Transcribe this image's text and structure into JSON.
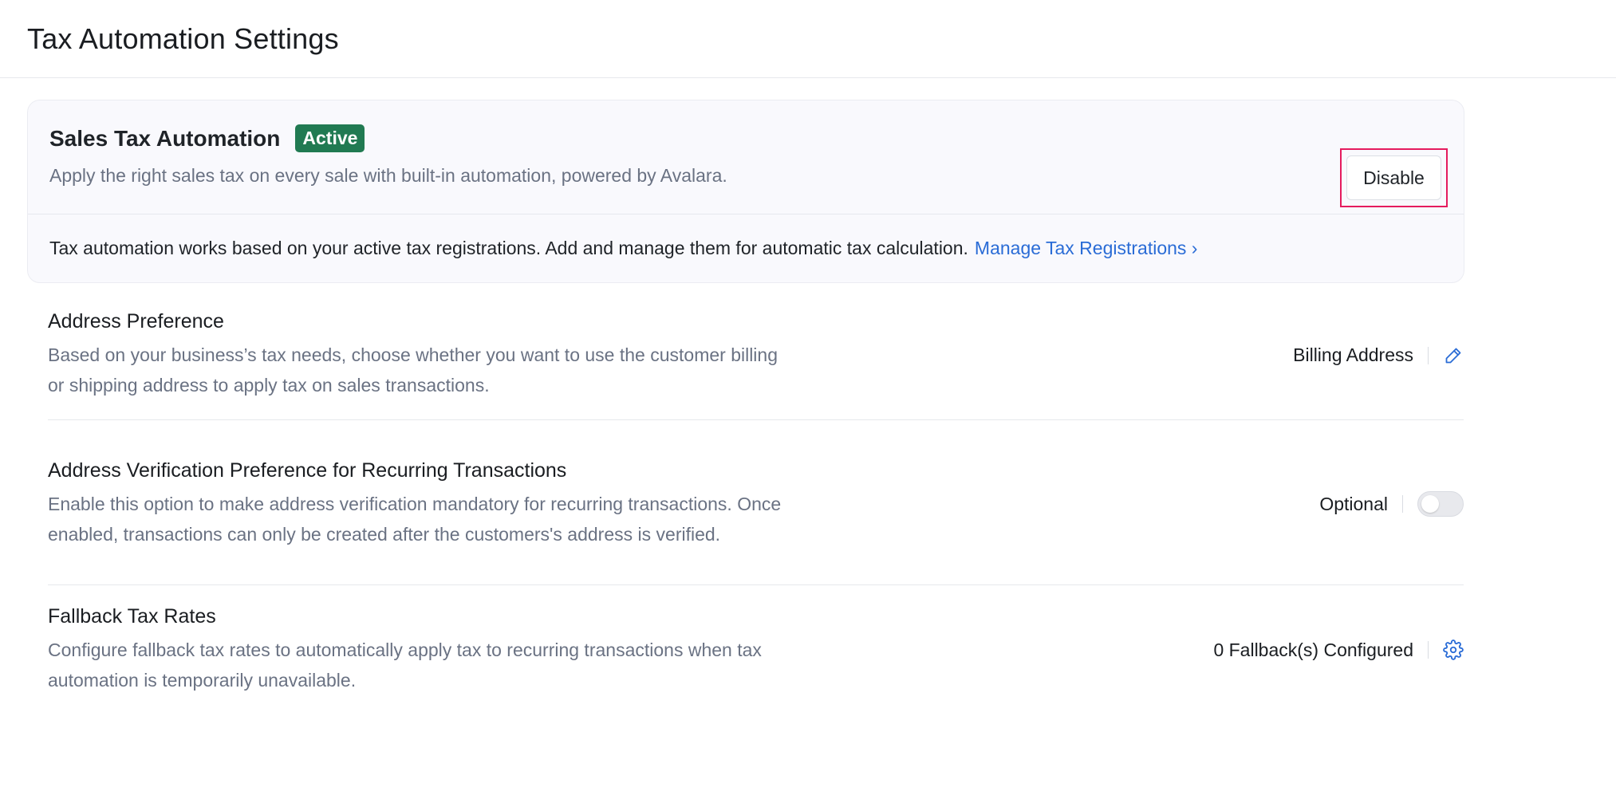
{
  "header": {
    "title": "Tax Automation Settings"
  },
  "automation_card": {
    "title": "Sales Tax Automation",
    "status_badge": "Active",
    "description": "Apply the right sales tax on every sale with built-in automation, powered by Avalara.",
    "disable_label": "Disable",
    "note": "Tax automation works based on your active tax registrations. Add and manage them for automatic tax calculation.",
    "manage_link": "Manage Tax Registrations ›"
  },
  "settings": [
    {
      "title": "Address Preference",
      "description": "Based on your business’s tax needs, choose whether you want to use the customer billing or shipping address to apply tax on sales transactions.",
      "value": "Billing Address",
      "action_icon": "pencil-icon"
    },
    {
      "title": "Address Verification Preference for Recurring Transactions",
      "description": "Enable this option to make address verification mandatory for recurring transactions. Once enabled, transactions can only be created after the customers's address is verified.",
      "value": "Optional",
      "toggle_on": false
    },
    {
      "title": "Fallback Tax Rates",
      "description": "Configure fallback tax rates to automatically apply tax to recurring transactions when tax automation is temporarily unavailable.",
      "value": "0 Fallback(s) Configured",
      "action_icon": "gear-icon"
    }
  ],
  "colors": {
    "accent": "#2a6cd6",
    "badge": "#217a52",
    "highlight": "#e51b5e"
  }
}
